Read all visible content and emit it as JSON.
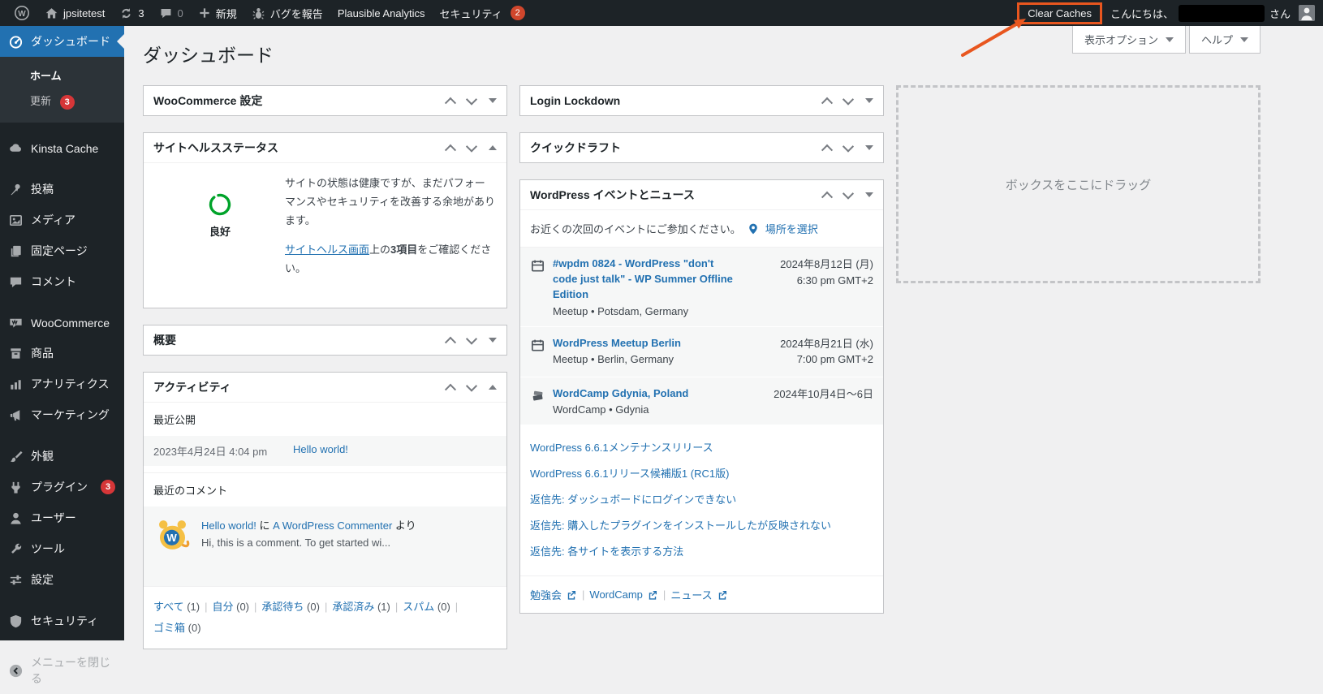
{
  "colors": {
    "accent_orange": "#e8561f",
    "link_blue": "#2271b1",
    "badge_red": "#d63638",
    "health_green": "#00a32a",
    "active_blue": "#2271b1"
  },
  "admin_bar": {
    "site_name": "jpsitetest",
    "updates_count": "3",
    "comments_count": "0",
    "new_label": "新規",
    "report_bug_label": "バグを報告",
    "plausible_label": "Plausible Analytics",
    "security_label": "セキュリティ",
    "security_badge": "2",
    "clear_caches_label": "Clear Caches",
    "greeting_prefix": "こんにちは、",
    "greeting_suffix": "さん"
  },
  "screen_controls": {
    "options_label": "表示オプション",
    "help_label": "ヘルプ"
  },
  "page_title": "ダッシュボード",
  "sidebar": {
    "dashboard": "ダッシュボード",
    "home": "ホーム",
    "updates": "更新",
    "updates_badge": "3",
    "kinsta": "Kinsta Cache",
    "posts": "投稿",
    "media": "メディア",
    "pages": "固定ページ",
    "comments": "コメント",
    "woocommerce": "WooCommerce",
    "products": "商品",
    "analytics": "アナリティクス",
    "marketing": "マーケティング",
    "appearance": "外観",
    "plugins": "プラグイン",
    "plugins_badge": "3",
    "users": "ユーザー",
    "tools": "ツール",
    "settings": "設定",
    "security": "セキュリティ",
    "collapse": "メニューを閉じる"
  },
  "widgets": {
    "woocommerce_settings_title": "WooCommerce 設定",
    "overview_title": "概要",
    "login_lockdown_title": "Login Lockdown",
    "quick_draft_title": "クイックドラフト",
    "drop_target_label": "ボックスをここにドラッグ",
    "site_health": {
      "title": "サイトヘルスステータス",
      "status_label": "良好",
      "text1": "サイトの状態は健康ですが、まだパフォーマンスやセキュリティを改善する余地があります。",
      "link_text": "サイトヘルス画面",
      "text2_pre": "上の",
      "text2_bold": "3項目",
      "text2_post": "をご確認ください。"
    },
    "activity": {
      "title": "アクティビティ",
      "recent_title": "最近公開",
      "post_date": "2023年4月24日 4:04 pm",
      "post_link": "Hello world!",
      "comments_title": "最近のコメント",
      "comment_post_link": "Hello world!",
      "comment_ni": " に ",
      "comment_author": "A WordPress Commenter",
      "comment_yori": " より",
      "comment_excerpt": "Hi, this is a comment. To get started wi...",
      "filters": [
        {
          "label": "すべて",
          "count": "(1)"
        },
        {
          "label": "自分",
          "count": "(0)"
        },
        {
          "label": "承認待ち",
          "count": "(0)"
        },
        {
          "label": "承認済み",
          "count": "(1)"
        },
        {
          "label": "スパム",
          "count": "(0)"
        },
        {
          "label": "ゴミ箱",
          "count": "(0)"
        }
      ]
    },
    "events": {
      "title": "WordPress イベントとニュース",
      "intro": "お近くの次回のイベントにご参加ください。",
      "location_link": "場所を選択",
      "items": [
        {
          "title": "#wpdm 0824 - WordPress \"don't code just talk\" - WP Summer Offline Edition",
          "meta": "Meetup • Potsdam, Germany",
          "date": "2024年8月12日 (月)",
          "time": "6:30 pm GMT+2"
        },
        {
          "title": "WordPress Meetup Berlin",
          "meta": "Meetup • Berlin, Germany",
          "date": "2024年8月21日 (水)",
          "time": "7:00 pm GMT+2"
        },
        {
          "title": "WordCamp Gdynia, Poland",
          "meta": "WordCamp • Gdynia",
          "date": "2024年10月4日〜6日",
          "time": ""
        }
      ],
      "news": [
        "WordPress 6.6.1メンテナンスリリース",
        "WordPress 6.6.1リリース候補版1 (RC1版)",
        "返信先: ダッシュボードにログインできない",
        "返信先: 購入したプラグインをインストールしたが反映されない",
        "返信先: 各サイトを表示する方法"
      ],
      "footer_links": [
        "勉強会",
        "WordCamp",
        "ニュース"
      ]
    }
  }
}
